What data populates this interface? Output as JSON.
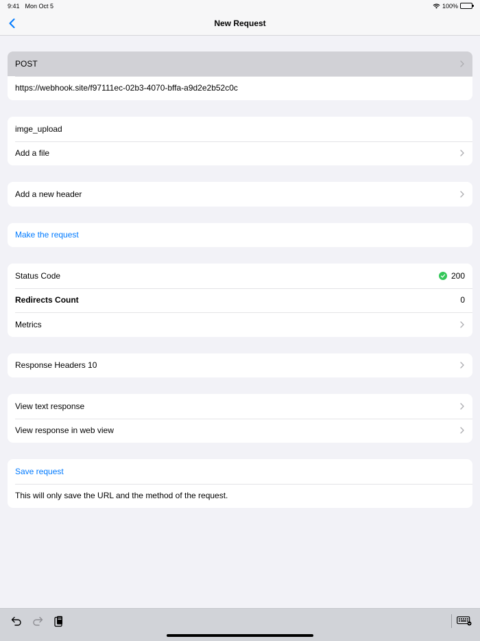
{
  "status_bar": {
    "time": "9:41",
    "date": "Mon Oct 5",
    "battery": "100%"
  },
  "nav": {
    "title": "New Request"
  },
  "request": {
    "method": "POST",
    "url": "https://webhook.site/f97111ec-02b3-4070-bffa-a9d2e2b52c0c"
  },
  "file": {
    "name": "imge_upload",
    "add_file": "Add a file"
  },
  "headers": {
    "add_header": "Add a new header"
  },
  "actions": {
    "make_request": "Make the request"
  },
  "result": {
    "status_code_label": "Status Code",
    "status_code_value": "200",
    "redirects_label": "Redirects Count",
    "redirects_value": "0",
    "metrics_label": "Metrics"
  },
  "response_headers": {
    "label": "Response Headers 10"
  },
  "views": {
    "text_response": "View text response",
    "web_view": "View response in web view"
  },
  "save": {
    "save_request": "Save request",
    "note": "This will only save the URL and the method of the request."
  },
  "colors": {
    "accent": "#007aff",
    "success": "#34c759",
    "background": "#f2f2f7"
  }
}
